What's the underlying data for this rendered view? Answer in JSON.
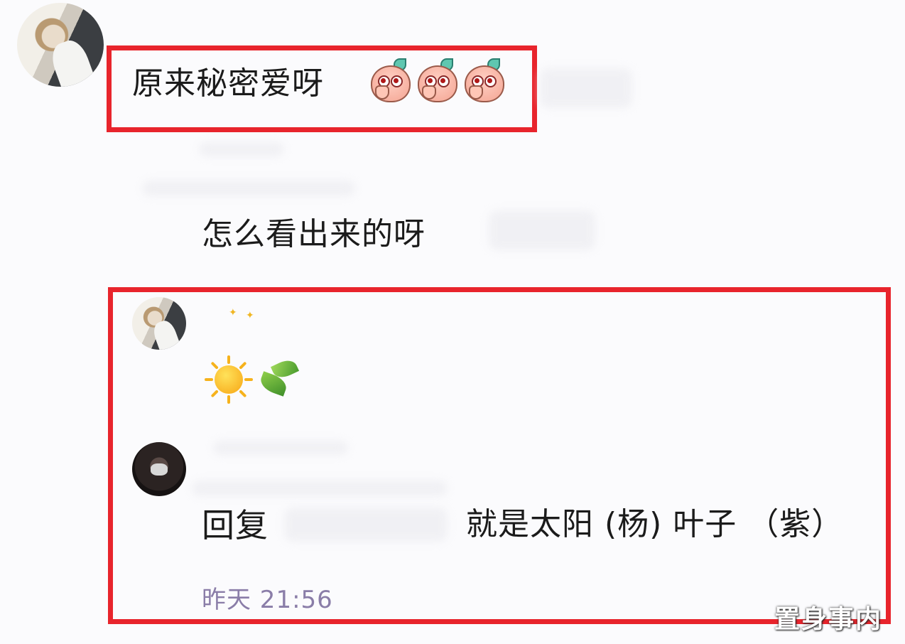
{
  "comments": [
    {
      "text": "原来秘密爱呀",
      "emoji_count": 3,
      "emoji_icon": "peach-covering-mouth-emoji"
    },
    {
      "text": "怎么看出来的呀"
    },
    {
      "emojis": [
        "sun-icon",
        "leaf-icon"
      ]
    },
    {
      "reply_prefix": "回复",
      "reply_text": "就是太阳 (杨) 叶子 （紫）",
      "timestamp": "昨天 21:56"
    }
  ],
  "highlight_color": "#e8242c",
  "watermark": "置身事内"
}
